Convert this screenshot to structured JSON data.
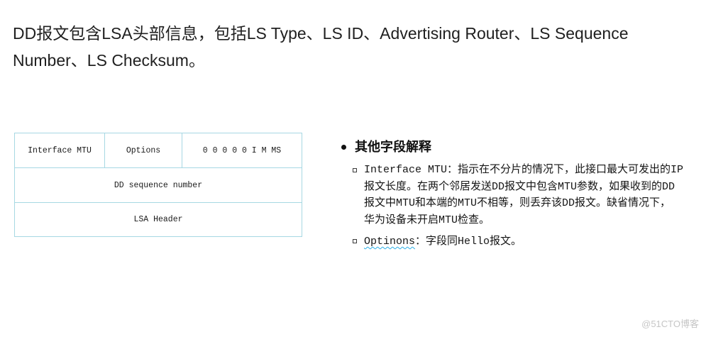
{
  "title": {
    "lines": [
      "DD报文包含LSA头部信息，包括LS Type、LS ID、Advertising Router、LS Sequence",
      "Number、LS Checksum。"
    ]
  },
  "packet_table": {
    "rows": [
      [
        "Interface MTU",
        "Options",
        "0 0 0 0 0 I M MS"
      ],
      [
        "DD sequence number"
      ],
      [
        "LSA Header"
      ]
    ]
  },
  "explanation": {
    "heading": "其他字段解释",
    "items": [
      {
        "lines": [
          "Interface MTU：指示在不分片的情况下，此接口最大可发出的IP",
          "报文长度。在两个邻居发送DD报文中包含MTU参数，如果收到的DD",
          "报文中MTU和本端的MTU不相等，则丢弃该DD报文。缺省情况下，",
          "华为设备未开启MTU检查。"
        ]
      },
      {
        "term": "Optinons",
        "text": "：字段同Hello报文。"
      }
    ]
  },
  "watermark": "@51CTO博客",
  "icons": {
    "main_bullet": "bullet-dot-icon",
    "sub_bullet": "hollow-square-icon"
  },
  "colors": {
    "text": "#1a1a1a",
    "table_border": "#a7d8e3",
    "spellcheck_underline": "#2aaee6",
    "watermark": "#c6c6c6"
  }
}
